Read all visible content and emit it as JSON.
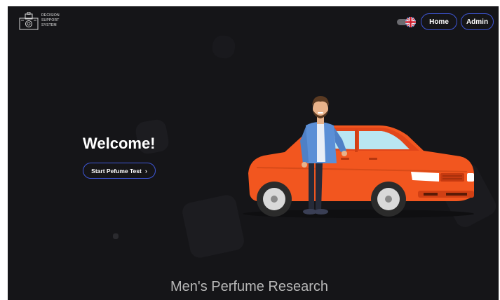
{
  "header": {
    "logo_lines": [
      "DECISION",
      "SUPPORT",
      "SYSTEM"
    ],
    "home_label": "Home",
    "admin_label": "Admin",
    "language_icon": "uk-flag-icon"
  },
  "hero": {
    "title": "Welcome!",
    "cta_label": "Start Pefume Test",
    "cta_icon": "chevron-right-icon",
    "illustration": "man-leaning-on-orange-car"
  },
  "section": {
    "title": "Men's Perfume Research"
  },
  "colors": {
    "background": "#151518",
    "button_border": "#3e56d6",
    "car": "#f2561f"
  }
}
